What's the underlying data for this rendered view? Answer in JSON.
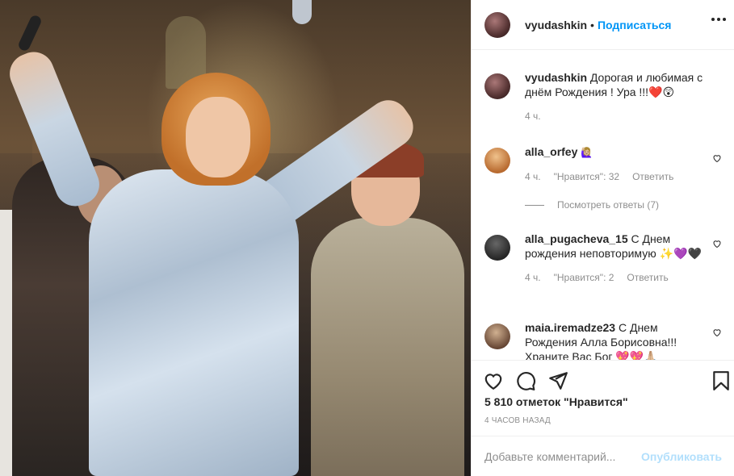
{
  "post": {
    "image_alt": "",
    "author": "vyudashkin",
    "follow_label": "Подписаться",
    "separator": "•"
  },
  "caption": {
    "username": "vyudashkin",
    "text": "Дорогая и любимая с днём Рождения ! Ура !!!❤️😲",
    "age": "4 ч."
  },
  "comments": [
    {
      "username": "alla_orfey",
      "text": "🙋🏼‍♀️",
      "age": "4 ч.",
      "likes": "\"Нравится\": 32",
      "reply_label": "Ответить"
    },
    {
      "username": "alla_pugacheva_15",
      "text": "С Днем рождения неповторимую ✨💜🖤",
      "age": "4 ч.",
      "likes": "\"Нравится\": 2",
      "reply_label": "Ответить"
    },
    {
      "username": "maia.iremadze23",
      "text": "С Днем Рождения Алла Борисовна!!! Храните Вас Бог 💖💖🙏🏼"
    }
  ],
  "replies_label": "Посмотреть ответы (7)",
  "actions": {
    "likes_text": "5 810 отметок \"Нравится\"",
    "timestamp": "4 ЧАСОВ НАЗАД"
  },
  "comment_box": {
    "placeholder": "Добавьте комментарий...",
    "publish_label": "Опубликовать"
  },
  "icons": [
    "more-options-icon",
    "heart-icon",
    "comment-icon",
    "share-icon",
    "bookmark-icon",
    "comment-like-icon"
  ],
  "colors": {
    "link_blue": "#0095f6",
    "publish_disabled": "#b2dffc",
    "secondary_text": "#8e8e8e",
    "primary_text": "#262626"
  }
}
